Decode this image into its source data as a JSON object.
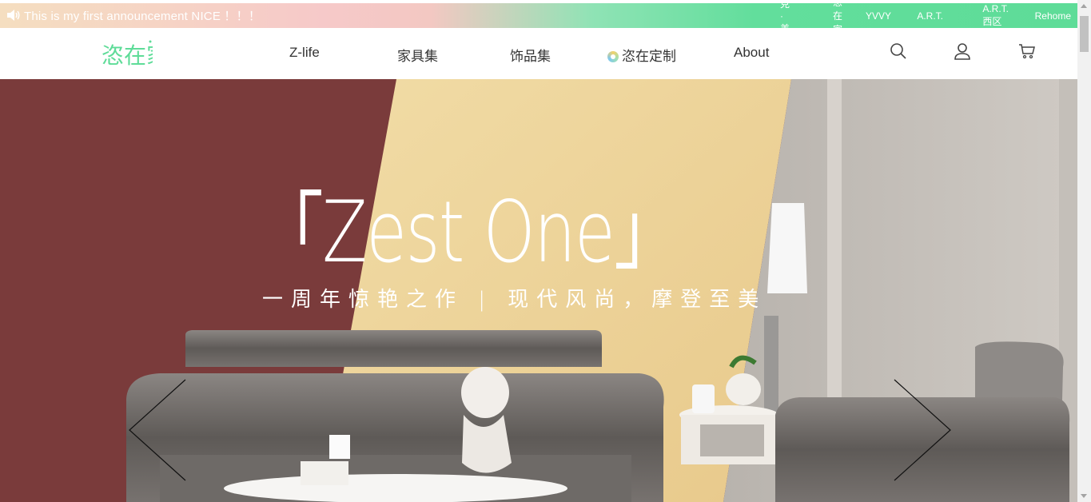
{
  "announcement": {
    "icon": "speaker-icon",
    "text": "This is my first announcement NICE ！！！",
    "links": [
      "美克·美家",
      "恣在家",
      "YVVY",
      "A.R.T.",
      "A.R.T.西区",
      "Rehome"
    ]
  },
  "header": {
    "logo_text": "恣在家",
    "nav": [
      "Z-life",
      "家具集",
      "饰品集",
      "恣在定制",
      "About"
    ],
    "icons": [
      "search-icon",
      "user-icon",
      "cart-icon"
    ]
  },
  "hero": {
    "title": "「Zest One」",
    "subtitle": "一周年惊艳之作 | 现代风尚，摩登至美"
  },
  "colors": {
    "brand_green": "#5edc98",
    "wall_red": "#7a3b3b",
    "wall_yellow": "#efd9a3"
  }
}
